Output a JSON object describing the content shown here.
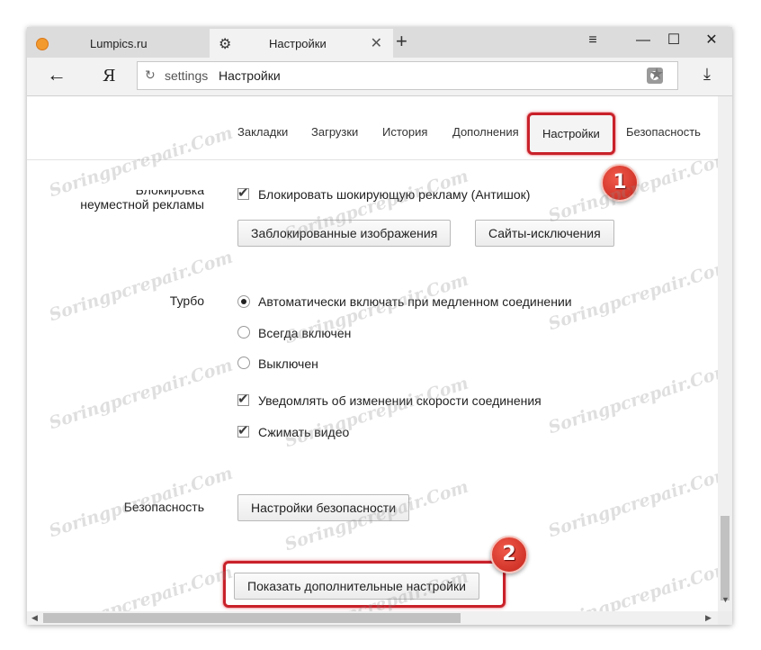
{
  "tabs": [
    {
      "title": "Lumpics.ru",
      "icon": "orange-favicon-icon"
    },
    {
      "title": "Настройки",
      "icon": "gear-icon",
      "close": "✕"
    }
  ],
  "new_tab": "+",
  "window_controls": {
    "menu": "≡",
    "minimize": "—",
    "maximize": "☐",
    "close": "✕"
  },
  "nav": {
    "back": "←",
    "yandex": "Я",
    "omnibox_url": "settings",
    "omnibox_title": "Настройки"
  },
  "settings_tabs": [
    "Закладки",
    "Загрузки",
    "История",
    "Дополнения",
    "Настройки",
    "Безопасность"
  ],
  "ads_block": {
    "label_line1": "Блокировка",
    "label_line2": "неуместной рекламы",
    "checkbox": "Блокировать шокирующую рекламу (Антишок)",
    "btn_blocked_images": "Заблокированные изображения",
    "btn_exceptions": "Сайты-исключения"
  },
  "turbo": {
    "label": "Турбо",
    "radio_auto": "Автоматически включать при медленном соединении",
    "radio_always": "Всегда включен",
    "radio_off": "Выключен",
    "check_notify": "Уведомлять об изменении скорости соединения",
    "check_compress": "Сжимать видео"
  },
  "security": {
    "label": "Безопасность",
    "button": "Настройки безопасности"
  },
  "show_more_button": "Показать дополнительные настройки",
  "badges": [
    "1",
    "2"
  ],
  "watermark": "Soringpcrepair.Com",
  "colors": {
    "highlight": "#c9212a",
    "badge": "#d9362b"
  }
}
